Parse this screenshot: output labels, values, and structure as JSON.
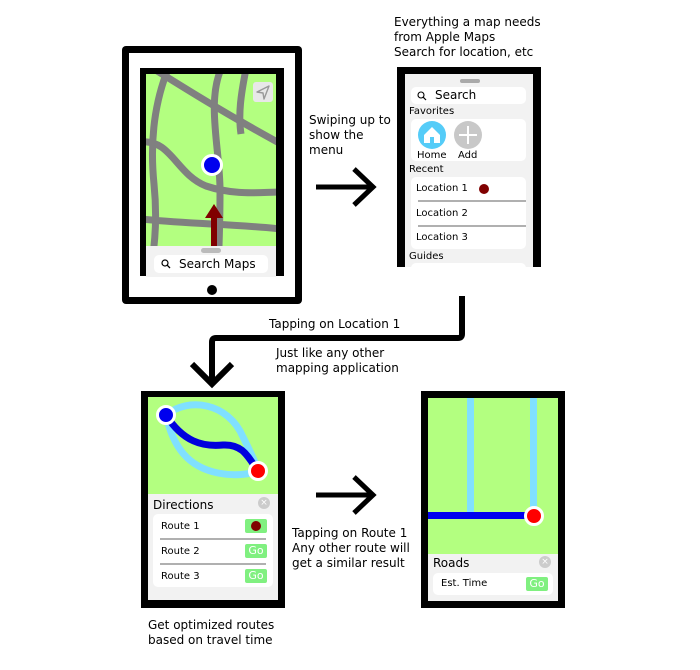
{
  "captions": {
    "swipe": "Swiping up to\nshow the\nmenu",
    "menu_desc": "Everything a map needs\nfrom Apple Maps\nSearch for location, etc",
    "tap_location": "Tapping on Location 1",
    "mapping_app": "Just like any other\nmapping application",
    "tap_route": "Tapping on Route 1\nAny other route will\nget a similar result",
    "optimized": "Get optimized routes\nbased on travel time"
  },
  "screen1": {
    "search_label": "Search Maps",
    "location_button_icon": "location-arrow-icon"
  },
  "screen2": {
    "search_label": "Search",
    "favorites_heading": "Favorites",
    "favorites": [
      {
        "label": "Home",
        "icon": "home-icon",
        "color": "#55ccf8"
      },
      {
        "label": "Add",
        "icon": "plus-icon",
        "color": "#c8c8c8"
      }
    ],
    "recent_heading": "Recent",
    "recent": [
      {
        "label": "Location 1",
        "tapped": true
      },
      {
        "label": "Location 2",
        "tapped": false
      },
      {
        "label": "Location 3",
        "tapped": false
      }
    ],
    "guides_heading": "Guides"
  },
  "screen3": {
    "title": "Directions",
    "routes": [
      {
        "label": "Route 1",
        "button": "Go",
        "tapped": true
      },
      {
        "label": "Route 2",
        "button": "Go",
        "tapped": false
      },
      {
        "label": "Route 3",
        "button": "Go",
        "tapped": false
      }
    ]
  },
  "screen4": {
    "title": "Roads",
    "row_label": "Est. Time",
    "button": "Go"
  },
  "colors": {
    "map_green": "#b3ff80",
    "road_gray": "#808080",
    "user_blue": "#0000ee",
    "dest_red": "#ff0000",
    "route_light": "#80e0ff",
    "route_dark": "#0000dd",
    "tap_marker": "#800000",
    "go_green": "#80f080"
  }
}
